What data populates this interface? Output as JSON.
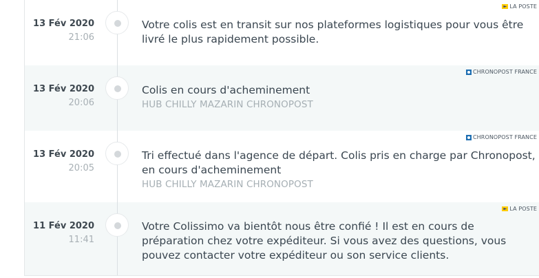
{
  "events": [
    {
      "date": "13 Fév 2020",
      "time": "21:06",
      "carrier": "LA POSTE",
      "message": "Votre colis est en transit sur nos plateformes logistiques pour vous être livré le plus rapidement possible.",
      "location": ""
    },
    {
      "date": "13 Fév 2020",
      "time": "20:06",
      "carrier": "CHRONOPOST FRANCE",
      "message": "Colis en cours d'acheminement",
      "location": "HUB CHILLY MAZARIN CHRONOPOST"
    },
    {
      "date": "13 Fév 2020",
      "time": "20:05",
      "carrier": "CHRONOPOST FRANCE",
      "message": "Tri effectué dans l'agence de départ. Colis pris en charge par Chronopost, en cours d'acheminement",
      "location": "HUB CHILLY MAZARIN CHRONOPOST"
    },
    {
      "date": "11 Fév 2020",
      "time": "11:41",
      "carrier": "LA POSTE",
      "message": "Votre Colissimo va bientôt nous être confié ! Il est en cours de préparation chez votre expéditeur. Si vous avez des questions, vous pouvez contacter votre expéditeur ou son service clients.",
      "location": ""
    }
  ],
  "icons": {
    "la_poste": "la-poste-logo-icon",
    "chronopost": "chronopost-logo-icon",
    "timeline_dot": "timeline-dot-icon"
  },
  "colors": {
    "shaded_row": "#f4f8f8",
    "text": "#3a4650",
    "muted": "#a8b0b5",
    "la_poste_yellow": "#ffcc00",
    "chronopost_blue": "#1f6fb2"
  }
}
